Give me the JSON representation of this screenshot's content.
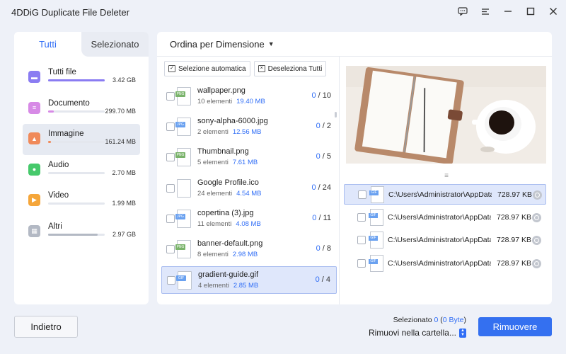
{
  "app": {
    "title": "4DDiG Duplicate File Deleter"
  },
  "window_controls": [
    "feedback-icon",
    "menu-icon",
    "minimize-icon",
    "maximize-icon",
    "close-icon"
  ],
  "left": {
    "tabs": [
      {
        "label": "Tutti",
        "active": true
      },
      {
        "label": "Selezionato",
        "active": false
      }
    ],
    "categories": [
      {
        "name": "Tutti file",
        "size": "3.42 GB",
        "icon": "folder-icon",
        "color": "#8a7cf2",
        "fill": 1.0
      },
      {
        "name": "Documento",
        "size": "299.70 MB",
        "icon": "document-icon",
        "color": "#d78ae6",
        "fill": 0.1
      },
      {
        "name": "Immagine",
        "size": "161.24 MB",
        "icon": "image-icon",
        "color": "#f08a5a",
        "fill": 0.05,
        "selected": true
      },
      {
        "name": "Audio",
        "size": "2.70 MB",
        "icon": "microphone-icon",
        "color": "#46c96b",
        "fill": 0.0
      },
      {
        "name": "Video",
        "size": "1.99 MB",
        "icon": "video-icon",
        "color": "#f5a63a",
        "fill": 0.0
      },
      {
        "name": "Altri",
        "size": "2.97 GB",
        "icon": "grid-icon",
        "color": "#b3b9c4",
        "fill": 0.87
      }
    ]
  },
  "main": {
    "sort_label": "Ordina per Dimensione",
    "toolbar": {
      "auto_select": "Selezione automatica",
      "deselect_all": "Deseleziona Tutti"
    },
    "files": [
      {
        "name": "wallpaper.png",
        "elements": "10 elementi",
        "size": "19.40 MB",
        "selected_count": "0",
        "total": "10",
        "type": "PNG",
        "tag_color": "#7ab36b"
      },
      {
        "name": "sony-alpha-6000.jpg",
        "elements": "2 elementi",
        "size": "12.56 MB",
        "selected_count": "0",
        "total": "2",
        "type": "JPG",
        "tag_color": "#6aa1f0"
      },
      {
        "name": "Thumbnail.png",
        "elements": "5 elementi",
        "size": "7.61 MB",
        "selected_count": "0",
        "total": "5",
        "type": "PNG",
        "tag_color": "#7ab36b"
      },
      {
        "name": "Google Profile.ico",
        "elements": "24 elementi",
        "size": "4.54 MB",
        "selected_count": "0",
        "total": "24",
        "type": "",
        "tag_color": ""
      },
      {
        "name": "copertina (3).jpg",
        "elements": "11 elementi",
        "size": "4.08 MB",
        "selected_count": "0",
        "total": "11",
        "type": "JPG",
        "tag_color": "#6aa1f0"
      },
      {
        "name": "banner-default.png",
        "elements": "8 elementi",
        "size": "2.98 MB",
        "selected_count": "0",
        "total": "8",
        "type": "PNG",
        "tag_color": "#7ab36b"
      },
      {
        "name": "gradient-guide.gif",
        "elements": "4 elementi",
        "size": "2.85 MB",
        "selected_count": "0",
        "total": "4",
        "type": "GIF",
        "tag_color": "#6aa1f0",
        "selected": true
      }
    ],
    "duplicates": [
      {
        "path": "C:\\Users\\Administrator\\AppData\\Local",
        "size": "728.97 KB",
        "selected": true
      },
      {
        "path": "C:\\Users\\Administrator\\AppData\\Local",
        "size": "728.97 KB"
      },
      {
        "path": "C:\\Users\\Administrator\\AppData\\Local",
        "size": "728.97 KB"
      },
      {
        "path": "C:\\Users\\Administrator\\AppData\\Local",
        "size": "728.97 KB"
      }
    ],
    "dup_type": "GIF"
  },
  "footer": {
    "back_label": "Indietro",
    "selected_prefix": "Selezionato",
    "selected_count": "0",
    "selected_bytes": "0 Byte",
    "move_label": "Rimuovi nella cartella...",
    "remove_label": "Rimuovere"
  },
  "colors": {
    "accent": "#2f6df6",
    "button": "#3470f0"
  }
}
